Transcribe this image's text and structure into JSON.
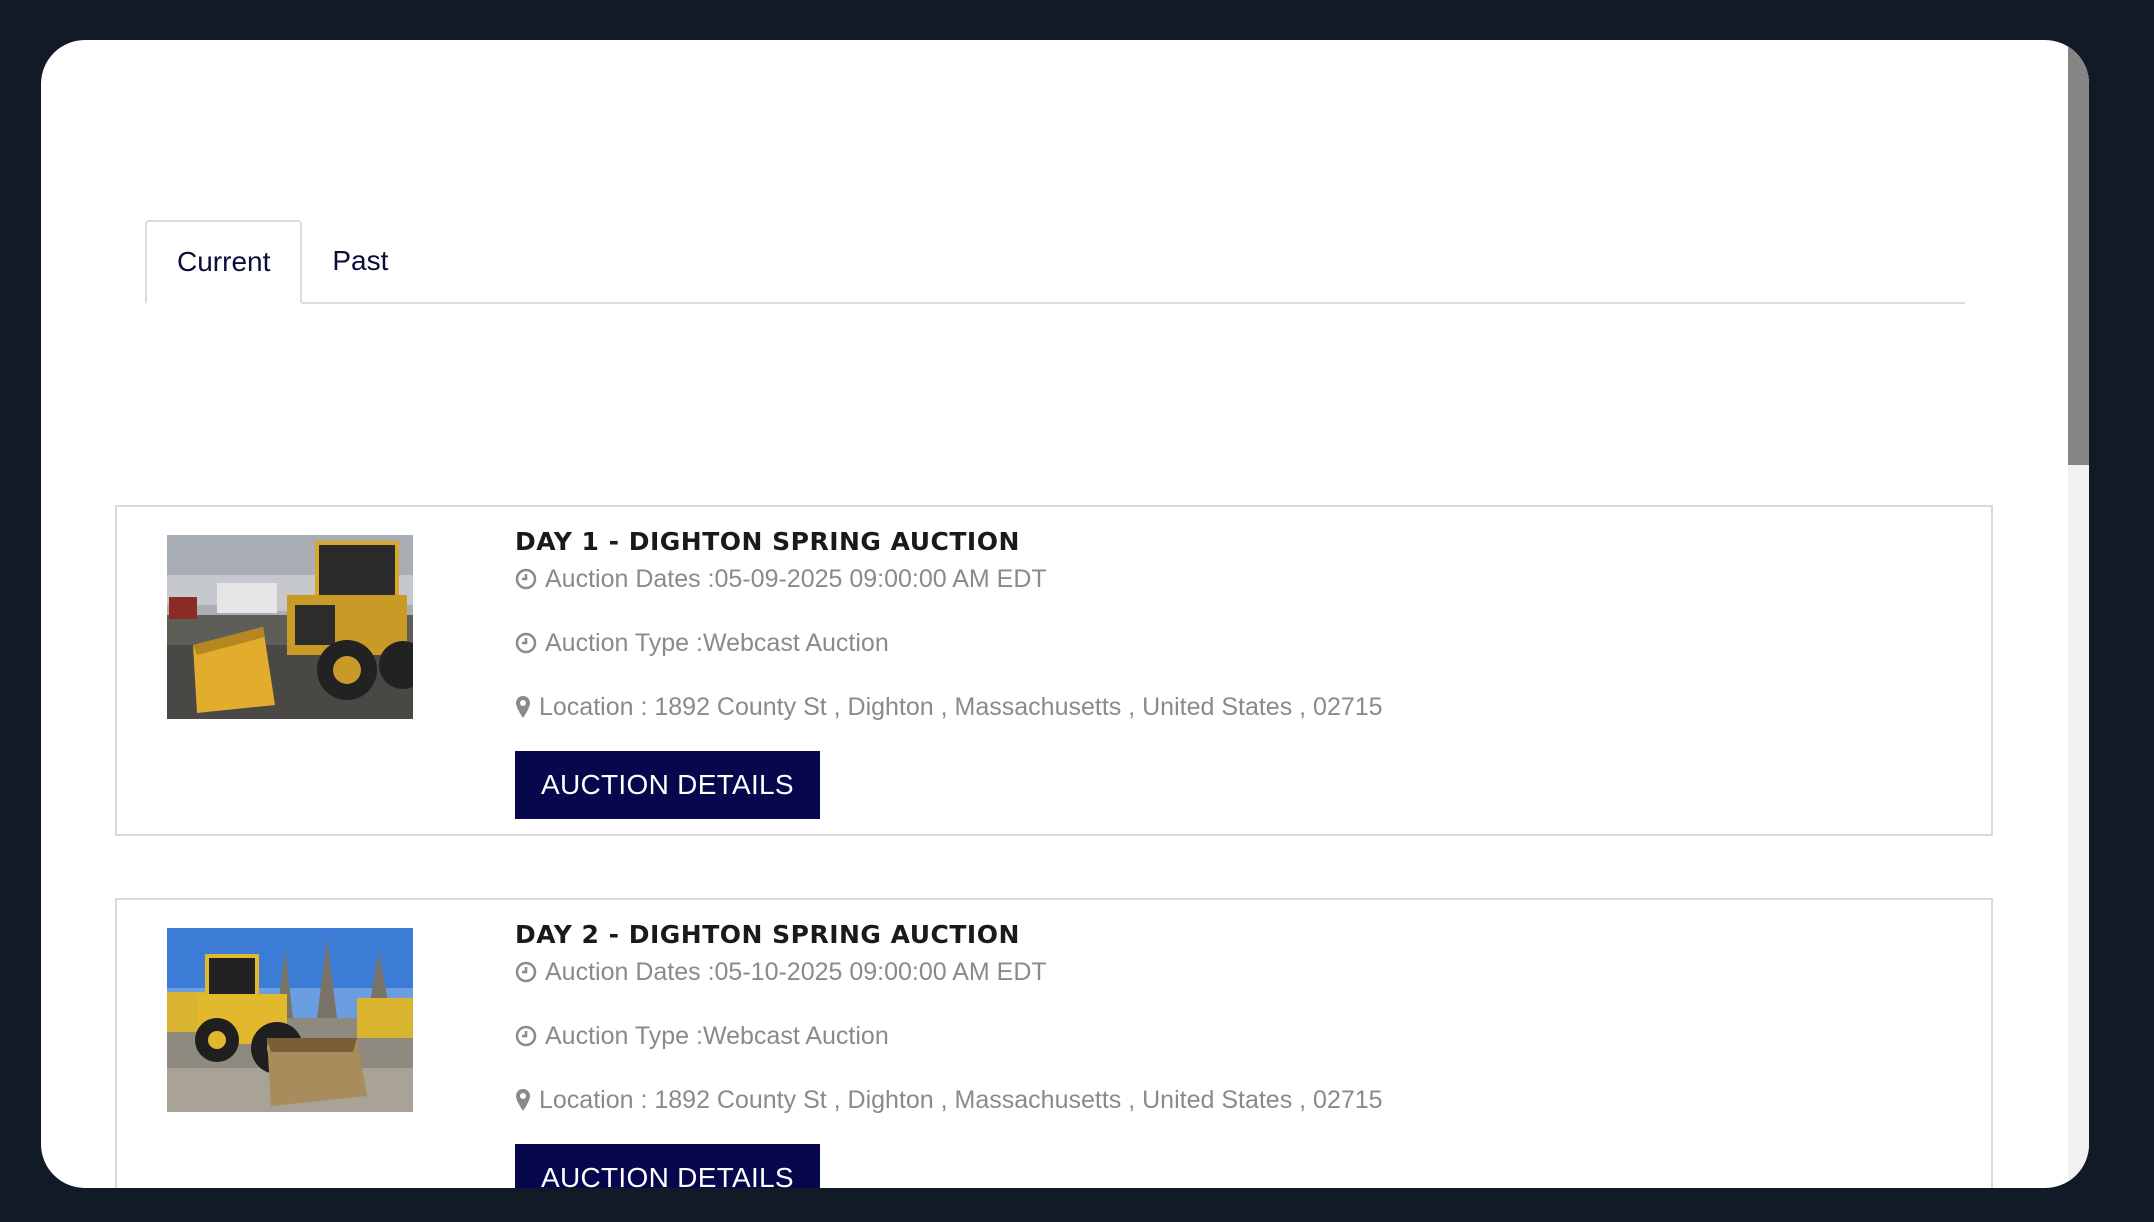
{
  "tabs": [
    {
      "label": "Current",
      "active": true
    },
    {
      "label": "Past",
      "active": false
    }
  ],
  "auctions": [
    {
      "title": "DAY 1 - DIGHTON SPRING AUCTION",
      "dates": "Auction Dates :05-09-2025 09:00:00 AM EDT",
      "type": "Auction Type :Webcast Auction",
      "location": "Location : 1892 County St , Dighton , Massachusetts , United States , 02715",
      "button": "AUCTION DETAILS",
      "image": "wheel-loader-photo"
    },
    {
      "title": "DAY 2 - DIGHTON SPRING AUCTION",
      "dates": "Auction Dates :05-10-2025 09:00:00 AM EDT",
      "type": "Auction Type :Webcast Auction",
      "location": "Location : 1892 County St , Dighton , Massachusetts , United States , 02715",
      "button": "AUCTION DETAILS",
      "image": "wheel-loader-photo"
    }
  ],
  "icons": {
    "date": "clock-icon",
    "type": "clock-icon",
    "location": "map-marker-icon"
  },
  "colors": {
    "button_bg": "#07074d",
    "page_bg": "#121a28",
    "tab_text": "#0a0c3c"
  }
}
